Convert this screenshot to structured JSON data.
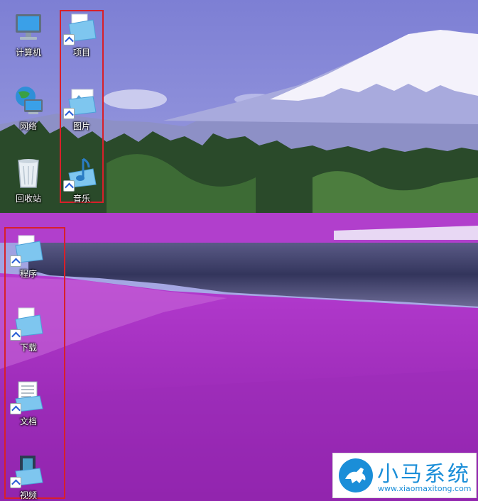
{
  "desktop": {
    "icons": [
      {
        "label": "计算机",
        "type": "computer",
        "shortcut": false
      },
      {
        "label": "网络",
        "type": "network",
        "shortcut": false
      },
      {
        "label": "回收站",
        "type": "recycle-bin",
        "shortcut": false
      },
      {
        "label": "项目",
        "type": "folder",
        "shortcut": true
      },
      {
        "label": "图片",
        "type": "pictures",
        "shortcut": true
      },
      {
        "label": "音乐",
        "type": "music",
        "shortcut": true
      },
      {
        "label": "程序",
        "type": "folder",
        "shortcut": true
      },
      {
        "label": "下载",
        "type": "downloads",
        "shortcut": true
      },
      {
        "label": "文档",
        "type": "documents",
        "shortcut": true
      },
      {
        "label": "视频",
        "type": "videos",
        "shortcut": true
      }
    ]
  },
  "watermark": {
    "brand": "小马系统",
    "url": "www.xiaomaxitong.com",
    "icon": "horse-logo-icon"
  },
  "colors": {
    "highlight_box": "#d8202a",
    "brand_blue": "#1a8ed8",
    "sky": "#8f93d8",
    "flowers": "#a12bc4"
  }
}
